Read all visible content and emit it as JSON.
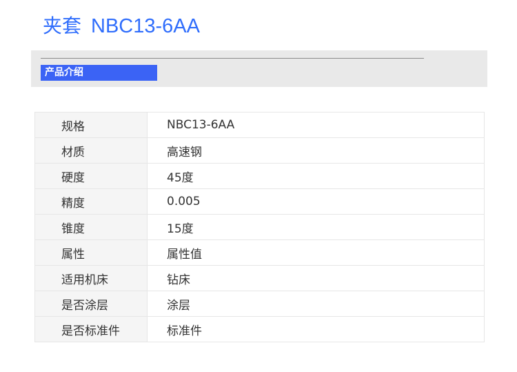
{
  "header": {
    "title_prefix": "夹套",
    "title_model": "NBC13-6AA"
  },
  "section": {
    "label": "产品介绍"
  },
  "specs": [
    {
      "label": "规格",
      "value": "NBC13-6AA"
    },
    {
      "label": "材质",
      "value": "高速钢"
    },
    {
      "label": "硬度",
      "value": "45度"
    },
    {
      "label": "精度",
      "value": "0.005"
    },
    {
      "label": "锥度",
      "value": "15度"
    },
    {
      "label": "属性",
      "value": "属性值"
    },
    {
      "label": "适用机床",
      "value": "钻床"
    },
    {
      "label": "是否涂层",
      "value": "涂层"
    },
    {
      "label": "是否标准件",
      "value": "标准件"
    }
  ],
  "colors": {
    "title": "#2f6dfc",
    "section_tag_bg": "#3b63f5",
    "band_bg": "#e9e9e9",
    "label_cell_bg": "#f5f5f5",
    "border": "#e6e6e6",
    "text": "#333333"
  }
}
